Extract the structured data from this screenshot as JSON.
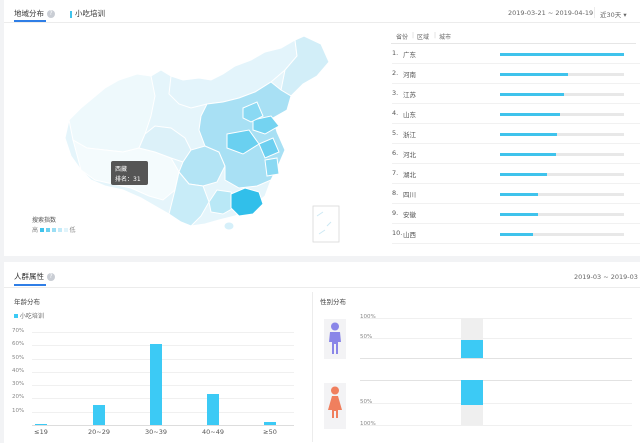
{
  "region": {
    "tabs": [
      {
        "label": "地域分布",
        "selected": true
      },
      {
        "label": "小吃培训",
        "selected": false
      }
    ],
    "date_range": "2019-03-21 ~ 2019-04-19",
    "period": "近30天",
    "tooltip": {
      "province": "西藏",
      "rank_label": "排名：31"
    },
    "legend": {
      "title": "搜索指数",
      "high": "高",
      "low": "低",
      "colors": [
        "#3fc3ec",
        "#6bd1f0",
        "#9bdef4",
        "#c3eaf8",
        "#e1f4fb"
      ]
    },
    "ranking_tabs": [
      "省份",
      "区域",
      "城市"
    ],
    "ranking": [
      {
        "rank": "1.",
        "name": "广东",
        "value": 100
      },
      {
        "rank": "2.",
        "name": "河南",
        "value": 55
      },
      {
        "rank": "3.",
        "name": "江苏",
        "value": 52
      },
      {
        "rank": "4.",
        "name": "山东",
        "value": 48
      },
      {
        "rank": "5.",
        "name": "浙江",
        "value": 46
      },
      {
        "rank": "6.",
        "name": "河北",
        "value": 45
      },
      {
        "rank": "7.",
        "name": "湖北",
        "value": 38
      },
      {
        "rank": "8.",
        "name": "四川",
        "value": 31
      },
      {
        "rank": "9.",
        "name": "安徽",
        "value": 31
      },
      {
        "rank": "10.",
        "name": "山西",
        "value": 27
      }
    ]
  },
  "crowd": {
    "title": "人群属性",
    "date_range": "2019-03 ~ 2019-03",
    "age_title": "年龄分布",
    "gender_title": "性别分布"
  },
  "chart_data": [
    {
      "type": "bar",
      "title": "年龄分布",
      "series": [
        {
          "name": "小吃培训",
          "values": [
            1,
            15,
            61,
            23,
            2
          ],
          "color": "#3ccaf5"
        }
      ],
      "categories": [
        "≤19",
        "20~29",
        "30~39",
        "40~49",
        "≥50"
      ],
      "ylim": [
        0,
        70
      ],
      "yticks": [
        "10%",
        "20%",
        "30%",
        "40%",
        "50%",
        "60%",
        "70%"
      ],
      "grid": true
    },
    {
      "type": "bar",
      "title": "性别分布",
      "series": [
        {
          "name": "male",
          "values": [
            72
          ],
          "color": "#3ccaf5"
        },
        {
          "name": "female",
          "values": [
            28
          ],
          "color": "#3ccaf5"
        }
      ],
      "male_ticks": [
        "100%",
        "50%"
      ],
      "female_ticks": [
        "50%",
        "100%"
      ],
      "ylim": [
        0,
        100
      ],
      "male_color": "#8a86e8",
      "female_color": "#f07f5e"
    }
  ]
}
